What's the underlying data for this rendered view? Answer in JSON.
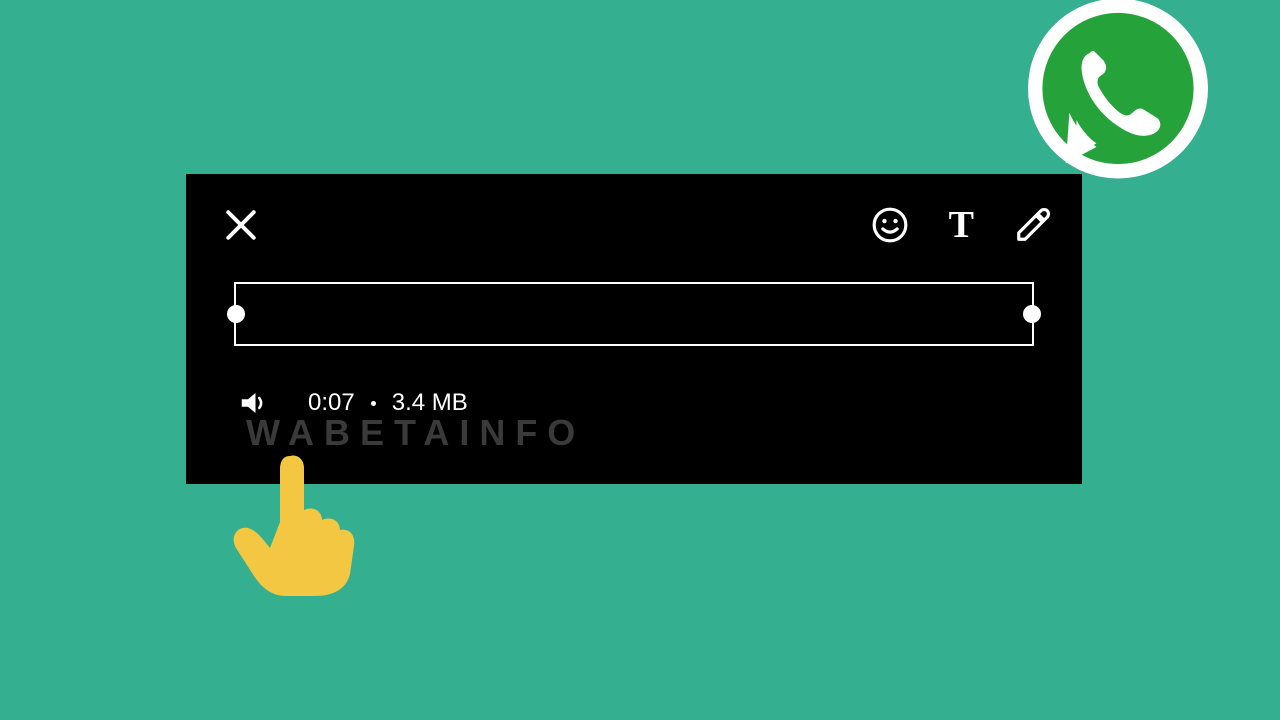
{
  "info": {
    "duration": "0:07",
    "size": "3.4 MB"
  },
  "watermark": "WABETAINFO",
  "textToolLabel": "T",
  "colors": {
    "bg": "#34af90",
    "panel": "#000000",
    "accent": "#25D366",
    "hand": "#f4c742"
  }
}
